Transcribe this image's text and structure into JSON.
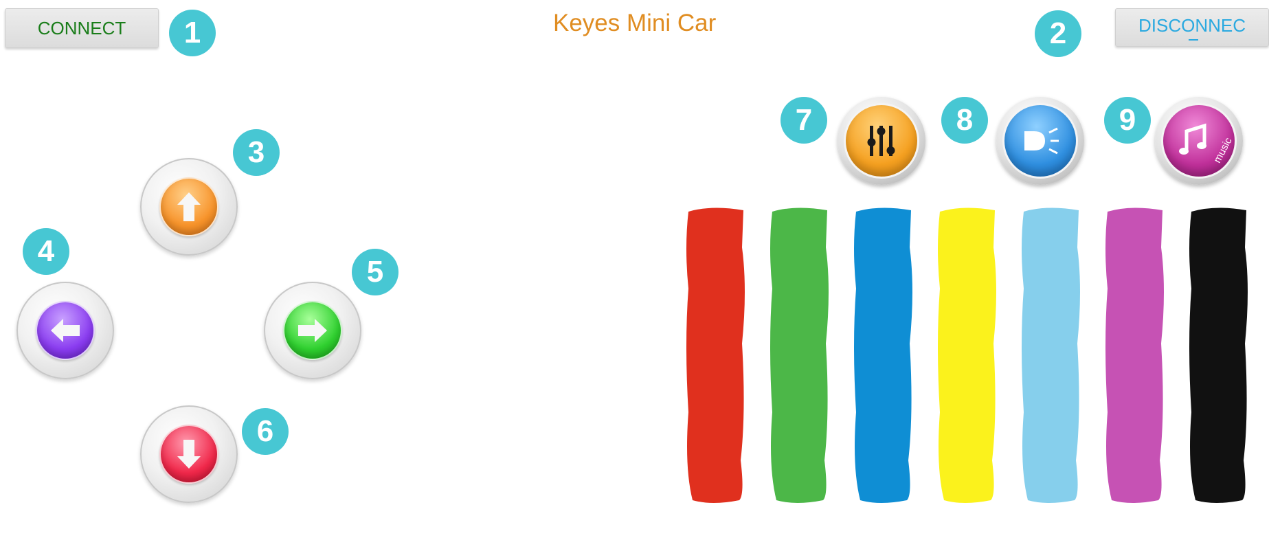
{
  "header": {
    "title": "Keyes Mini Car",
    "connect_label": "CONNECT",
    "disconnect_label": "DISCONNEC"
  },
  "markers": [
    "1",
    "2",
    "3",
    "4",
    "5",
    "6",
    "7",
    "8",
    "9"
  ],
  "colors": {
    "title": "#e08d22",
    "connect_text": "#1a7d1a",
    "disconnect_text": "#2aa9e0",
    "marker": "#47c7d3"
  },
  "controls": {
    "dpad": [
      "up-arrow-icon",
      "left-arrow-icon",
      "right-arrow-icon",
      "down-arrow-icon"
    ],
    "functions": [
      "sliders-icon",
      "headlight-icon",
      "music-icon"
    ]
  },
  "function_labels": {
    "music": "music"
  },
  "color_stripes": [
    "#e0301e",
    "#4cb748",
    "#0f8ed4",
    "#fbf21c",
    "#86cfec",
    "#c652b4",
    "#111111"
  ]
}
